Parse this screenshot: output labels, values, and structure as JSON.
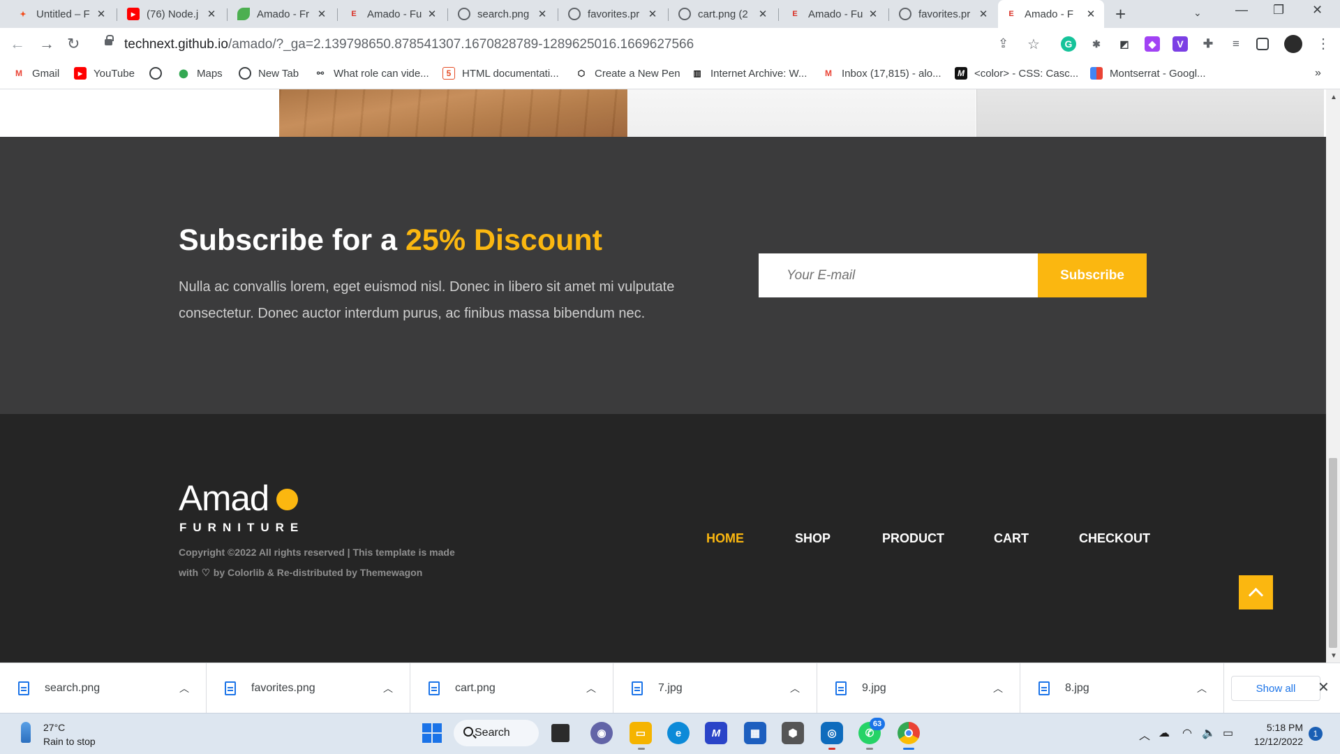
{
  "browser": {
    "tabs": [
      {
        "title": "Untitled – F",
        "favicon": "figma-icon",
        "color": "#f24e1e"
      },
      {
        "title": "(76) Node.j",
        "favicon": "youtube-icon",
        "color": "#ff0000"
      },
      {
        "title": "Amado - Fr",
        "favicon": "amado-leaf-icon",
        "color": "#4caf50"
      },
      {
        "title": "Amado - Fu",
        "favicon": "e-icon",
        "color": "#d93025"
      },
      {
        "title": "search.png",
        "favicon": "globe-icon",
        "color": "#5f6368"
      },
      {
        "title": "favorites.pr",
        "favicon": "globe-icon",
        "color": "#5f6368"
      },
      {
        "title": "cart.png (2",
        "favicon": "globe-icon",
        "color": "#5f6368"
      },
      {
        "title": "Amado - Fu",
        "favicon": "e-icon",
        "color": "#d93025"
      },
      {
        "title": "favorites.pr",
        "favicon": "globe-icon",
        "color": "#5f6368"
      },
      {
        "title": "Amado - F",
        "favicon": "e-icon",
        "color": "#d93025",
        "active": true
      }
    ],
    "url_domain": "technext.github.io",
    "url_path": "/amado/?_ga=2.139798650.878541307.1670828789-1289625016.1669627566",
    "bookmarks": [
      {
        "label": "Gmail",
        "icon": "gmail-icon"
      },
      {
        "label": "YouTube",
        "icon": "youtube-icon"
      },
      {
        "label": "",
        "icon": "globe-icon"
      },
      {
        "label": "Maps",
        "icon": "maps-icon"
      },
      {
        "label": "New Tab",
        "icon": "globe-icon"
      },
      {
        "label": "What role can vide...",
        "icon": "link-icon"
      },
      {
        "label": "HTML documentati...",
        "icon": "html-icon"
      },
      {
        "label": "Create a New Pen",
        "icon": "codepen-icon"
      },
      {
        "label": "Internet Archive: W...",
        "icon": "archive-icon"
      },
      {
        "label": "Inbox (17,815) - alo...",
        "icon": "gmail-icon"
      },
      {
        "label": "<color> - CSS: Casc...",
        "icon": "mdn-icon"
      },
      {
        "label": "Montserrat - Googl...",
        "icon": "google-fonts-icon"
      }
    ]
  },
  "page": {
    "subscribe": {
      "title_prefix": "Subscribe for a ",
      "title_highlight": "25% Discount",
      "text": "Nulla ac convallis lorem, eget euismod nisl. Donec in libero sit amet mi vulputate consectetur. Donec auctor interdum purus, ac finibus massa bibendum nec.",
      "email_placeholder": "Your E-mail",
      "button_label": "Subscribe"
    },
    "footer": {
      "logo": "Amad",
      "logo_sub": "FURNITURE",
      "copyright_1": "Copyright ©2022 All rights reserved | This template is made",
      "copyright_with": "with",
      "copyright_2": "by Colorlib & Re-distributed by Themewagon",
      "nav": [
        "HOME",
        "SHOP",
        "PRODUCT",
        "CART",
        "CHECKOUT"
      ],
      "active_nav": "HOME"
    },
    "colors": {
      "accent": "#fbb710",
      "subscribe_bg": "#3b3b3c",
      "footer_bg": "#252525"
    }
  },
  "downloads": {
    "items": [
      "search.png",
      "favorites.png",
      "cart.png",
      "7.jpg",
      "9.jpg",
      "8.jpg"
    ],
    "show_all": "Show all"
  },
  "taskbar": {
    "temperature": "27°C",
    "weather": "Rain to stop",
    "search_label": "Search",
    "whatsapp_badge": "63",
    "time": "5:18 PM",
    "date": "12/12/2022",
    "notifications": "1"
  }
}
